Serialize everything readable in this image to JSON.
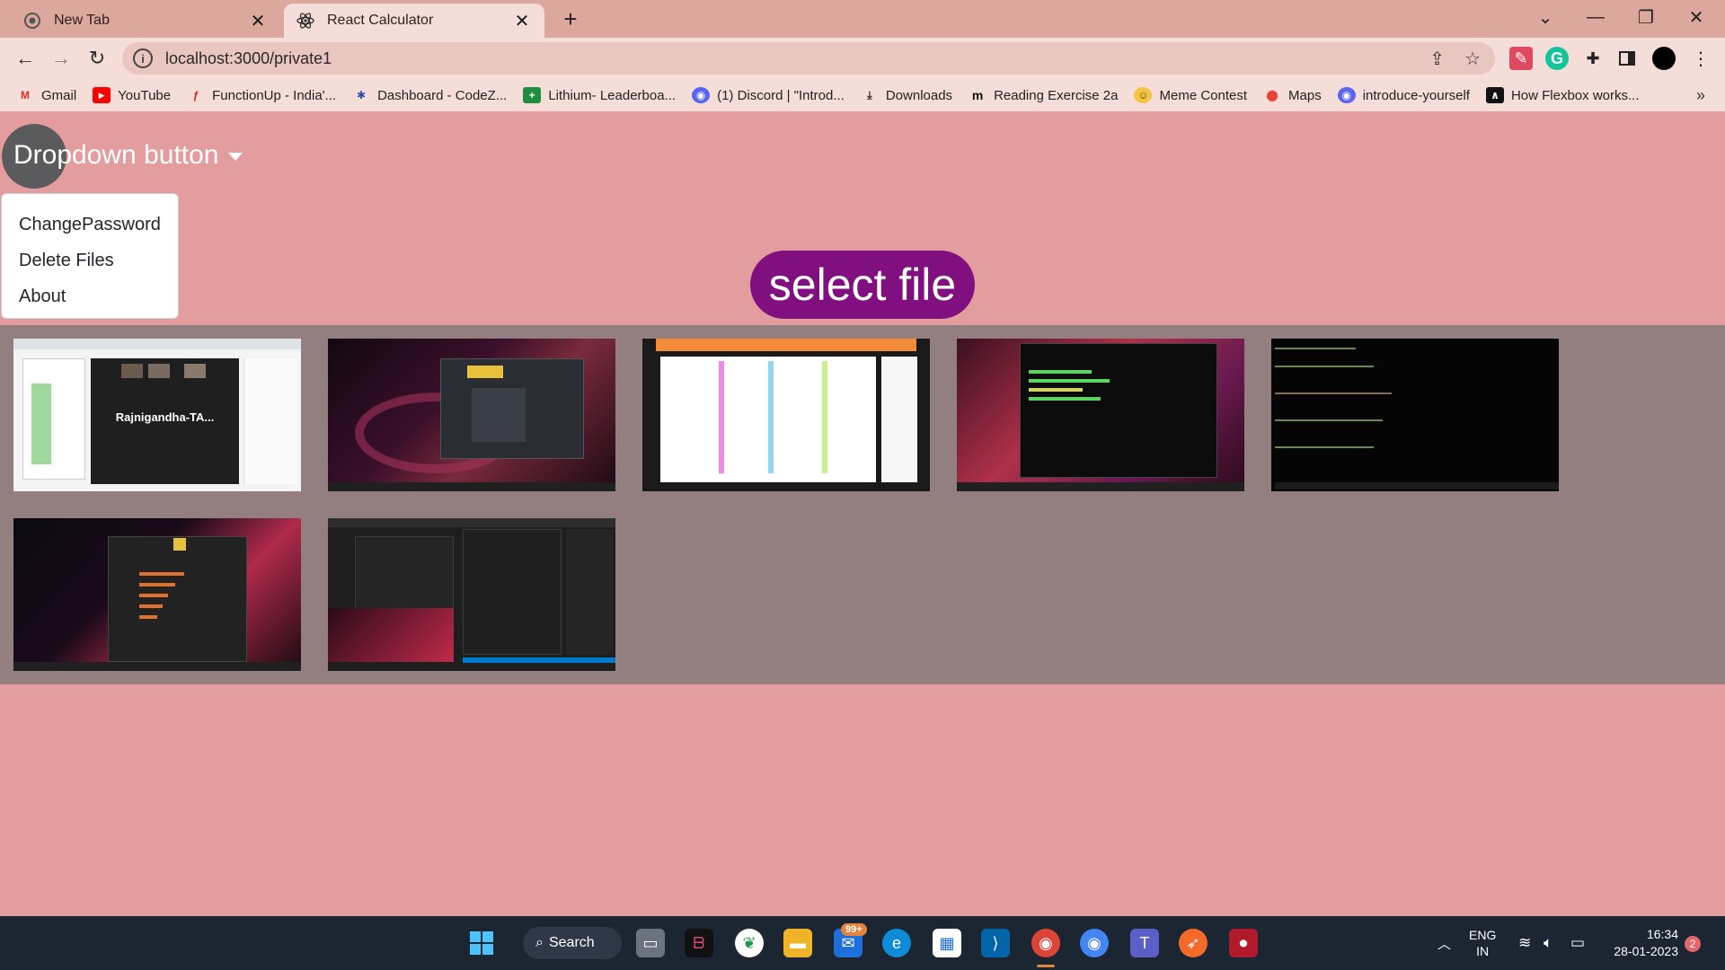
{
  "browser": {
    "tabs": [
      {
        "title": "New Tab",
        "active": false
      },
      {
        "title": "React Calculator",
        "active": true
      }
    ],
    "url": "localhost:3000/private1",
    "bookmarks": [
      {
        "label": "Gmail",
        "icon": "gmail-icon"
      },
      {
        "label": "YouTube",
        "icon": "youtube-icon"
      },
      {
        "label": "FunctionUp - India'...",
        "icon": "functionup-icon"
      },
      {
        "label": "Dashboard - CodeZ...",
        "icon": "codezinger-icon"
      },
      {
        "label": "Lithium- Leaderboa...",
        "icon": "sheets-icon"
      },
      {
        "label": "(1) Discord | \"Introd...",
        "icon": "discord-icon"
      },
      {
        "label": "Downloads",
        "icon": "download-icon"
      },
      {
        "label": "Reading Exercise 2a",
        "icon": "m-icon"
      },
      {
        "label": "Meme Contest",
        "icon": "emoji-icon"
      },
      {
        "label": "Maps",
        "icon": "maps-icon"
      },
      {
        "label": "introduce-yourself",
        "icon": "discord-icon"
      },
      {
        "label": "How Flexbox works...",
        "icon": "flexbox-icon"
      }
    ]
  },
  "app": {
    "dropdown_label": "Dropdown button",
    "menu": [
      "ChangePassword",
      "Delete Files",
      "About"
    ],
    "select_file_label": "select file",
    "thumbnails": [
      {
        "name": "meeting-screenshot",
        "caption": "Rajnigandha-TA..."
      },
      {
        "name": "desktop-screenshot-1",
        "caption": ""
      },
      {
        "name": "whiteboard-screenshot",
        "caption": ""
      },
      {
        "name": "terminal-desktop-screenshot",
        "caption": ""
      },
      {
        "name": "terminal-screenshot",
        "caption": ""
      },
      {
        "name": "chart-desktop-screenshot",
        "caption": ""
      },
      {
        "name": "code-editor-screenshot",
        "caption": ""
      }
    ]
  },
  "taskbar": {
    "search_label": "Search",
    "mail_badge": "99+",
    "language": "ENG",
    "region": "IN",
    "time": "16:34",
    "date": "28-01-2023",
    "notification_count": "2"
  },
  "colors": {
    "page_bg": "#e39d9e",
    "gallery_bg": "#947f80",
    "select_file_bg": "#800f80",
    "dropdown_circle": "#5b5b5e",
    "taskbar_bg": "#1c2532"
  }
}
